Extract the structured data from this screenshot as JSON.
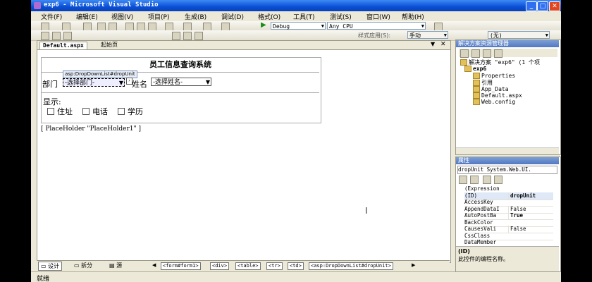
{
  "window": {
    "title": "exp6 - Microsoft Visual Studio"
  },
  "menu": [
    "文件(F)",
    "编辑(E)",
    "视图(V)",
    "项目(P)",
    "生成(B)",
    "调试(D)",
    "格式(O)",
    "工具(T)",
    "测试(S)",
    "窗口(W)",
    "帮助(H)"
  ],
  "toolbar": {
    "config": "Debug",
    "platform": "Any CPU",
    "style_apply": "样式应用(S):",
    "style_mode": "手动",
    "target": "(无)"
  },
  "tabs": {
    "active": "Default.aspx",
    "start": "起始页"
  },
  "form": {
    "title": "员工信息查询系统",
    "dept_label": "部门",
    "dept_select": "-选择部门-",
    "ddl_tip": "asp:DropDownList#dropUnit",
    "name_label": "姓名",
    "name_select": "-选择姓名-",
    "show_label": "显示:",
    "checks": [
      "住址",
      "电话",
      "学历"
    ]
  },
  "placeholder": "[ PlaceHolder \"PlaceHolder1\" ]",
  "views": {
    "design": "设计",
    "split": "拆分",
    "source": "源"
  },
  "breadcrumb": [
    "<form#form1>",
    "<div>",
    "<table>",
    "<tr>",
    "<td>",
    "<asp:DropDownList#dropUnit>"
  ],
  "status": "就绪",
  "solution": {
    "header": "解决方案资源管理器",
    "items": [
      "解决方案 \"exp6\" (1 个项",
      "exp6",
      "Properties",
      "引用",
      "App_Data",
      "Default.aspx",
      "Web.config"
    ]
  },
  "properties": {
    "header": "属性",
    "object": "dropUnit System.Web.UI.",
    "rows": [
      {
        "name": "(Expression",
        "value": ""
      },
      {
        "name": "(ID)",
        "value": "dropUnit"
      },
      {
        "name": "AccessKey",
        "value": ""
      },
      {
        "name": "AppendDataI",
        "value": "False"
      },
      {
        "name": "AutoPostBa",
        "value": "True"
      },
      {
        "name": "BackColor",
        "value": ""
      },
      {
        "name": "CausesVali",
        "value": "False"
      },
      {
        "name": "CssClass",
        "value": ""
      },
      {
        "name": "DataMember",
        "value": ""
      }
    ],
    "desc_title": "(ID)",
    "desc_text": "此控件的编程名称。"
  }
}
